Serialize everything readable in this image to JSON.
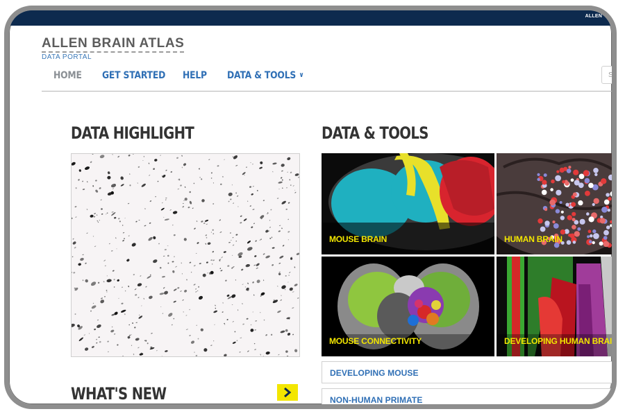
{
  "topbar": {
    "text": "ALLEN"
  },
  "logo": {
    "title": "ALLEN BRAIN ATLAS",
    "subtitle": "DATA PORTAL"
  },
  "nav": [
    {
      "label": "HOME"
    },
    {
      "label": "GET STARTED"
    },
    {
      "label": "HELP"
    },
    {
      "label": "DATA & TOOLS"
    }
  ],
  "search": {
    "placeholder": "Se"
  },
  "data_highlight": {
    "title": "DATA HIGHLIGHT"
  },
  "data_tools": {
    "title": "DATA & TOOLS",
    "tiles": [
      {
        "label": "MOUSE BRAIN"
      },
      {
        "label": "HUMAN BRAIN"
      },
      {
        "label": "MOUSE CONNECTIVITY"
      },
      {
        "label": "DEVELOPING HUMAN BRAIN"
      }
    ],
    "links": [
      {
        "label": "DEVELOPING MOUSE"
      },
      {
        "label": "NON-HUMAN PRIMATE"
      }
    ]
  },
  "whats_new": {
    "title": "WHAT'S NEW"
  },
  "colors": {
    "nav_link": "#2f6fb5",
    "nav_home": "#8a8f94",
    "tile_label": "#f2e600",
    "topbar": "#0d2a4e",
    "accent_yellow": "#f3e600"
  }
}
